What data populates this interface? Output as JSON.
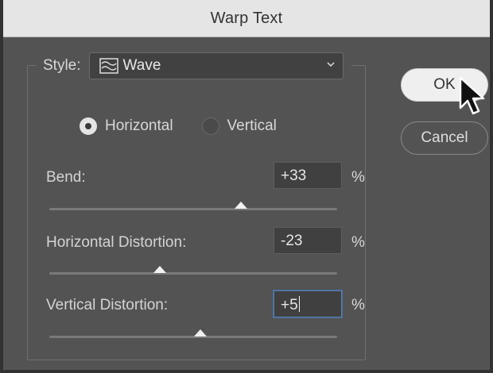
{
  "dialog": {
    "title": "Warp Text"
  },
  "style": {
    "label": "Style:",
    "value": "Wave"
  },
  "orientation": {
    "options": [
      {
        "label": "Horizontal",
        "selected": true
      },
      {
        "label": "Vertical",
        "selected": false
      }
    ]
  },
  "params": [
    {
      "label": "Bend:",
      "value": "+33",
      "unit": "%",
      "slider_percent": 33
    },
    {
      "label": "Horizontal Distortion:",
      "value": "-23",
      "unit": "%",
      "slider_percent": -23
    },
    {
      "label": "Vertical Distortion:",
      "value": "+5",
      "unit": "%",
      "slider_percent": 5
    }
  ],
  "buttons": {
    "ok": "OK",
    "cancel": "Cancel"
  },
  "colors": {
    "dialog_bg": "#535353",
    "titlebar_bg": "#e5e5e5",
    "focus_ring": "#5a7fb0"
  },
  "icons": {
    "style_icon": "wave-icon",
    "dropdown": "chevron-down-icon",
    "pointer": "mouse-cursor-icon"
  }
}
